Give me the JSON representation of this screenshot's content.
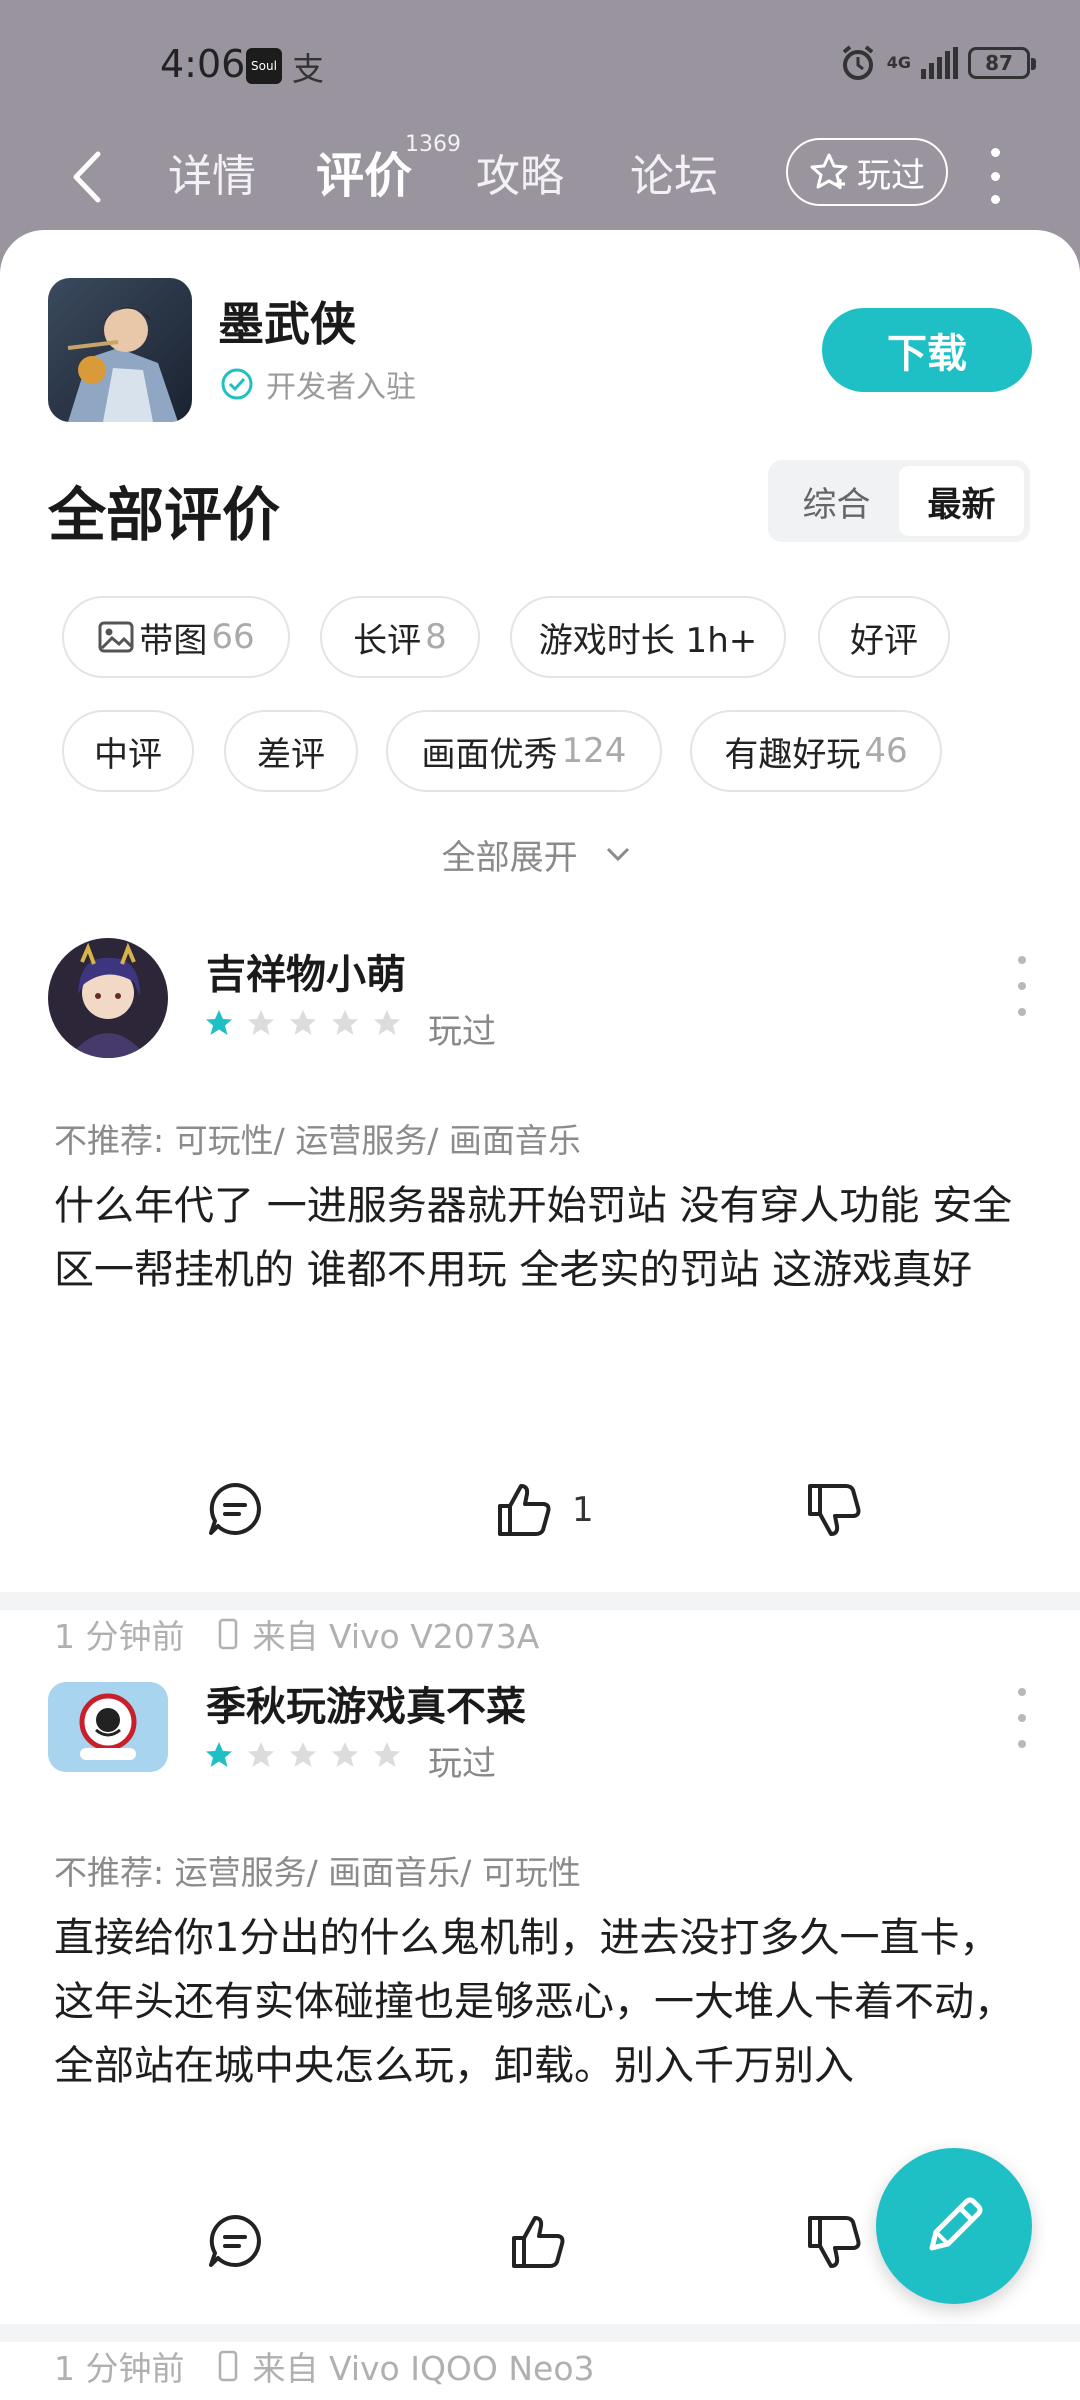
{
  "status_bar": {
    "time": "4:06",
    "app_badge": "Soul",
    "network": "4G",
    "battery": "87"
  },
  "nav": {
    "tabs": [
      {
        "label": "详情",
        "active": false
      },
      {
        "label": "评价",
        "active": true,
        "count": "1369"
      },
      {
        "label": "攻略",
        "active": false
      },
      {
        "label": "论坛",
        "active": false
      }
    ],
    "played_label": "玩过"
  },
  "game": {
    "title": "墨武侠",
    "dev_badge": "开发者入驻",
    "download_label": "下载"
  },
  "reviews_section": {
    "title": "全部评价",
    "sort_options": [
      "综合",
      "最新"
    ],
    "sort_selected": "最新",
    "filters": [
      {
        "label": "带图",
        "count": "66",
        "icon": "image-icon"
      },
      {
        "label": "长评",
        "count": "8"
      },
      {
        "label": "游戏时长 1h+",
        "count": ""
      },
      {
        "label": "好评",
        "count": ""
      },
      {
        "label": "中评",
        "count": ""
      },
      {
        "label": "差评",
        "count": ""
      },
      {
        "label": "画面优秀",
        "count": "124"
      },
      {
        "label": "有趣好玩",
        "count": "46"
      }
    ],
    "expand_label": "全部展开"
  },
  "reviews": [
    {
      "user": "吉祥物小萌",
      "rating": 1,
      "max_rating": 5,
      "status": "玩过",
      "tags": "不推荐: 可玩性/ 运营服务/ 画面音乐",
      "body": "什么年代了 一进服务器就开始罚站 没有穿人功能 安全区一帮挂机的 谁都不用玩 全老实的罚站 这游戏真好",
      "time": "1 分钟前",
      "device": "来自 Vivo V2073A",
      "likes": "1"
    },
    {
      "user": "季秋玩游戏真不菜",
      "rating": 1,
      "max_rating": 5,
      "status": "玩过",
      "tags": "不推荐: 运营服务/ 画面音乐/ 可玩性",
      "body": "直接给你1分出的什么鬼机制，进去没打多久一直卡，这年头还有实体碰撞也是够恶心，一大堆人卡着不动，全部站在城中央怎么玩，卸载。别入千万别入",
      "time": "1 分钟前",
      "device": "来自 Vivo IQOO Neo3",
      "likes": ""
    }
  ],
  "colors": {
    "accent": "#1fc0c5",
    "header_bg": "#9a949e",
    "star_active": "#1fc0c5",
    "star_inactive": "#dcdcdc"
  }
}
